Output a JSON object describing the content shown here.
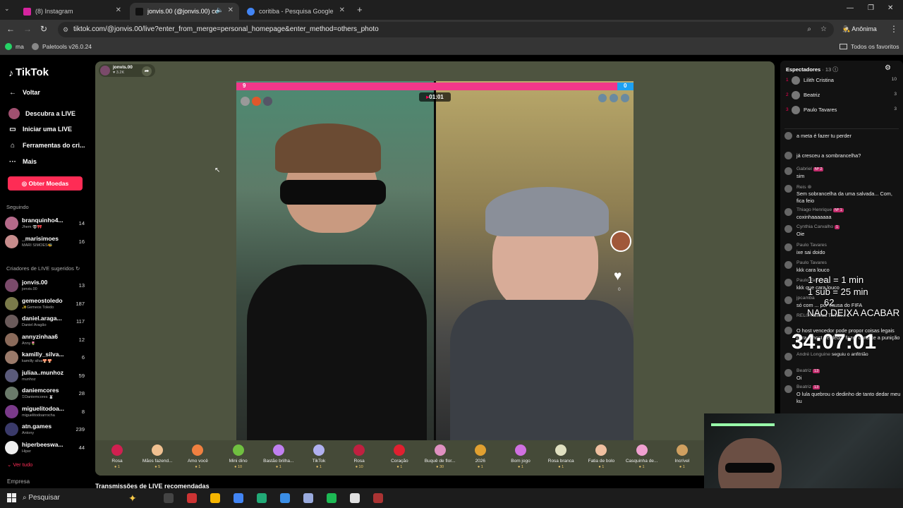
{
  "browser": {
    "tabs": [
      {
        "label": "(8) Instagram",
        "color": "#d6249f"
      },
      {
        "label": "jonvis.00 (@jonvis.00) come",
        "color": "#111111"
      },
      {
        "label": "coritiba - Pesquisa Google",
        "color": "#4285f4"
      }
    ],
    "url": "tiktok.com/@jonvis.00/live?enter_from_merge=personal_homepage&enter_method=others_photo",
    "profile": "Anônima",
    "bookmarks": {
      "left": [
        "ma",
        "Paletools v26.0.24"
      ],
      "right": "Todos os favoritos"
    }
  },
  "sidebar": {
    "logo": "TikTok",
    "back": "Voltar",
    "nav": [
      "Descubra a LIVE",
      "Iniciar uma LIVE",
      "Ferramentas do cri...",
      "Mais"
    ],
    "coins_button": "Obter Moedas",
    "following_header": "Seguindo",
    "following": [
      {
        "name": "branquinho4...",
        "sub": "Jhem 👽🎀",
        "count": "14",
        "color": "#b56a8a"
      },
      {
        "name": "_marisimoes",
        "sub": "MARI SIMÕES🐝",
        "count": "16",
        "color": "#c78c8c"
      }
    ],
    "creators_header": "Criadores de LIVE sugeridos",
    "creators": [
      {
        "name": "jonvis.00",
        "sub": "jonvis.00",
        "count": "13",
        "color": "#7a4a6a"
      },
      {
        "name": "gemeostoledo",
        "sub": "✨Gemeos Toledo",
        "count": "187",
        "color": "#7a7a4a"
      },
      {
        "name": "daniel.aragа...",
        "sub": "Daniel Aragão",
        "count": "117",
        "color": "#6a5a5a"
      },
      {
        "name": "annyzinhaa6",
        "sub": "Anny🌷",
        "count": "12",
        "color": "#8a6a5a"
      },
      {
        "name": "kamilly_silva...",
        "sub": "kamilly silva🍄🍄",
        "count": "6",
        "color": "#9a7a6a"
      },
      {
        "name": "juliaa..munhoz",
        "sub": "munhoz",
        "count": "59",
        "color": "#5a5a7a"
      },
      {
        "name": "daniemcores",
        "sub": "𝔇Daniemcores 🐰",
        "count": "28",
        "color": "#6a7a6a"
      },
      {
        "name": "miguelitodoa...",
        "sub": "miguelitodoarrocha",
        "count": "8",
        "color": "#7a3a8a"
      },
      {
        "name": "atn.games",
        "sub": "Antony",
        "count": "239",
        "color": "#3a3a6a"
      },
      {
        "name": "hiperbeeswa...",
        "sub": "Hiper",
        "count": "44",
        "color": "#eeeeee"
      }
    ],
    "see_all": "Ver tudo",
    "company": "Empresa"
  },
  "live": {
    "host_name": "jonvis.00",
    "host_likes": "3.2K",
    "score_left": "9",
    "score_right": "0",
    "timer": "01:01",
    "recommended": "Transmissões de LIVE recomendadas"
  },
  "gifts": [
    {
      "name": "Rosa",
      "price": "1",
      "color": "#d02050"
    },
    {
      "name": "Mãos fazend...",
      "price": "5",
      "color": "#f0c090"
    },
    {
      "name": "Amo você",
      "price": "1",
      "color": "#f08040"
    },
    {
      "name": "Mini dino",
      "price": "10",
      "color": "#70c040"
    },
    {
      "name": "Bastão brilha...",
      "price": "1",
      "color": "#c080f0"
    },
    {
      "name": "TikTok",
      "price": "1",
      "color": "#b0b0f0"
    },
    {
      "name": "Rosa",
      "price": "10",
      "color": "#c02040"
    },
    {
      "name": "Coração",
      "price": "1",
      "color": "#e02030"
    },
    {
      "name": "Buquê de flor...",
      "price": "30",
      "color": "#e090c0"
    },
    {
      "name": "2026",
      "price": "1",
      "color": "#e0a030"
    },
    {
      "name": "Bom jogo",
      "price": "1",
      "color": "#d070e0"
    },
    {
      "name": "Rosa branca",
      "price": "1",
      "color": "#e0e0c0"
    },
    {
      "name": "Fatia de bolo",
      "price": "1",
      "color": "#f0c0a0"
    },
    {
      "name": "Casquinha de...",
      "price": "1",
      "color": "#f0a0d0"
    },
    {
      "name": "Incrível",
      "price": "1",
      "color": "#d0a060"
    }
  ],
  "viewers": {
    "title": "Espectadores",
    "count": "13",
    "top": [
      {
        "rank": "1",
        "name": "Lilith Cristina",
        "count": "10"
      },
      {
        "rank": "2",
        "name": "Beatriz",
        "count": "3"
      },
      {
        "rank": "3",
        "name": "Paulo Tavares",
        "count": "3"
      }
    ]
  },
  "comments": [
    {
      "name": "",
      "text": "a meta é fazer tu perder"
    },
    {
      "name": "",
      "text": "já cresceu a sombrancelha?"
    },
    {
      "name": "Gabriel",
      "badge": "Nº 2",
      "text": "sim"
    },
    {
      "name": "Reis ⊛",
      "text": "Sem sobrancelha da uma salvada... Com, fica feio"
    },
    {
      "name": "Thiago Henrique",
      "badge": "Nº 1",
      "text": "coxinhaaaaaaa"
    },
    {
      "name": "Cynthia Carvalho",
      "badge": "1",
      "text": "Oie"
    },
    {
      "name": "Paulo Tavares",
      "text": "ixe sai doido"
    },
    {
      "name": "Paulo Tavares",
      "text": "kkk cara louco"
    },
    {
      "name": "Paulo Tavares",
      "text": "kkk que cara louco"
    },
    {
      "name": "jpcamba",
      "text": "só com ... por causa do FIFA"
    },
    {
      "name": "REL0A",
      "text": "enviou TikTok",
      "extra": "x 1"
    },
    {
      "name": "",
      "text": "O host vencedor pode propor coisas legais para o host perdedor fazer durante a punição"
    },
    {
      "name": "André Longuine",
      "text": "seguiu o anfitrião",
      "inline": true
    },
    {
      "name": "Beatriz",
      "badge": "13",
      "text": "Oi"
    },
    {
      "name": "Beatriz",
      "badge": "13",
      "text": "O lula quebrou o dedinho de tanto dedar meu ku"
    }
  ],
  "overlay": {
    "line1": "1 real = 1 min",
    "line2": "1 sub = 25 min",
    "line3": "NAO DEIXA ACABAR",
    "sub_count": "62",
    "timer": "34:07:01"
  },
  "taskbar": {
    "search": "Pesquisar"
  }
}
